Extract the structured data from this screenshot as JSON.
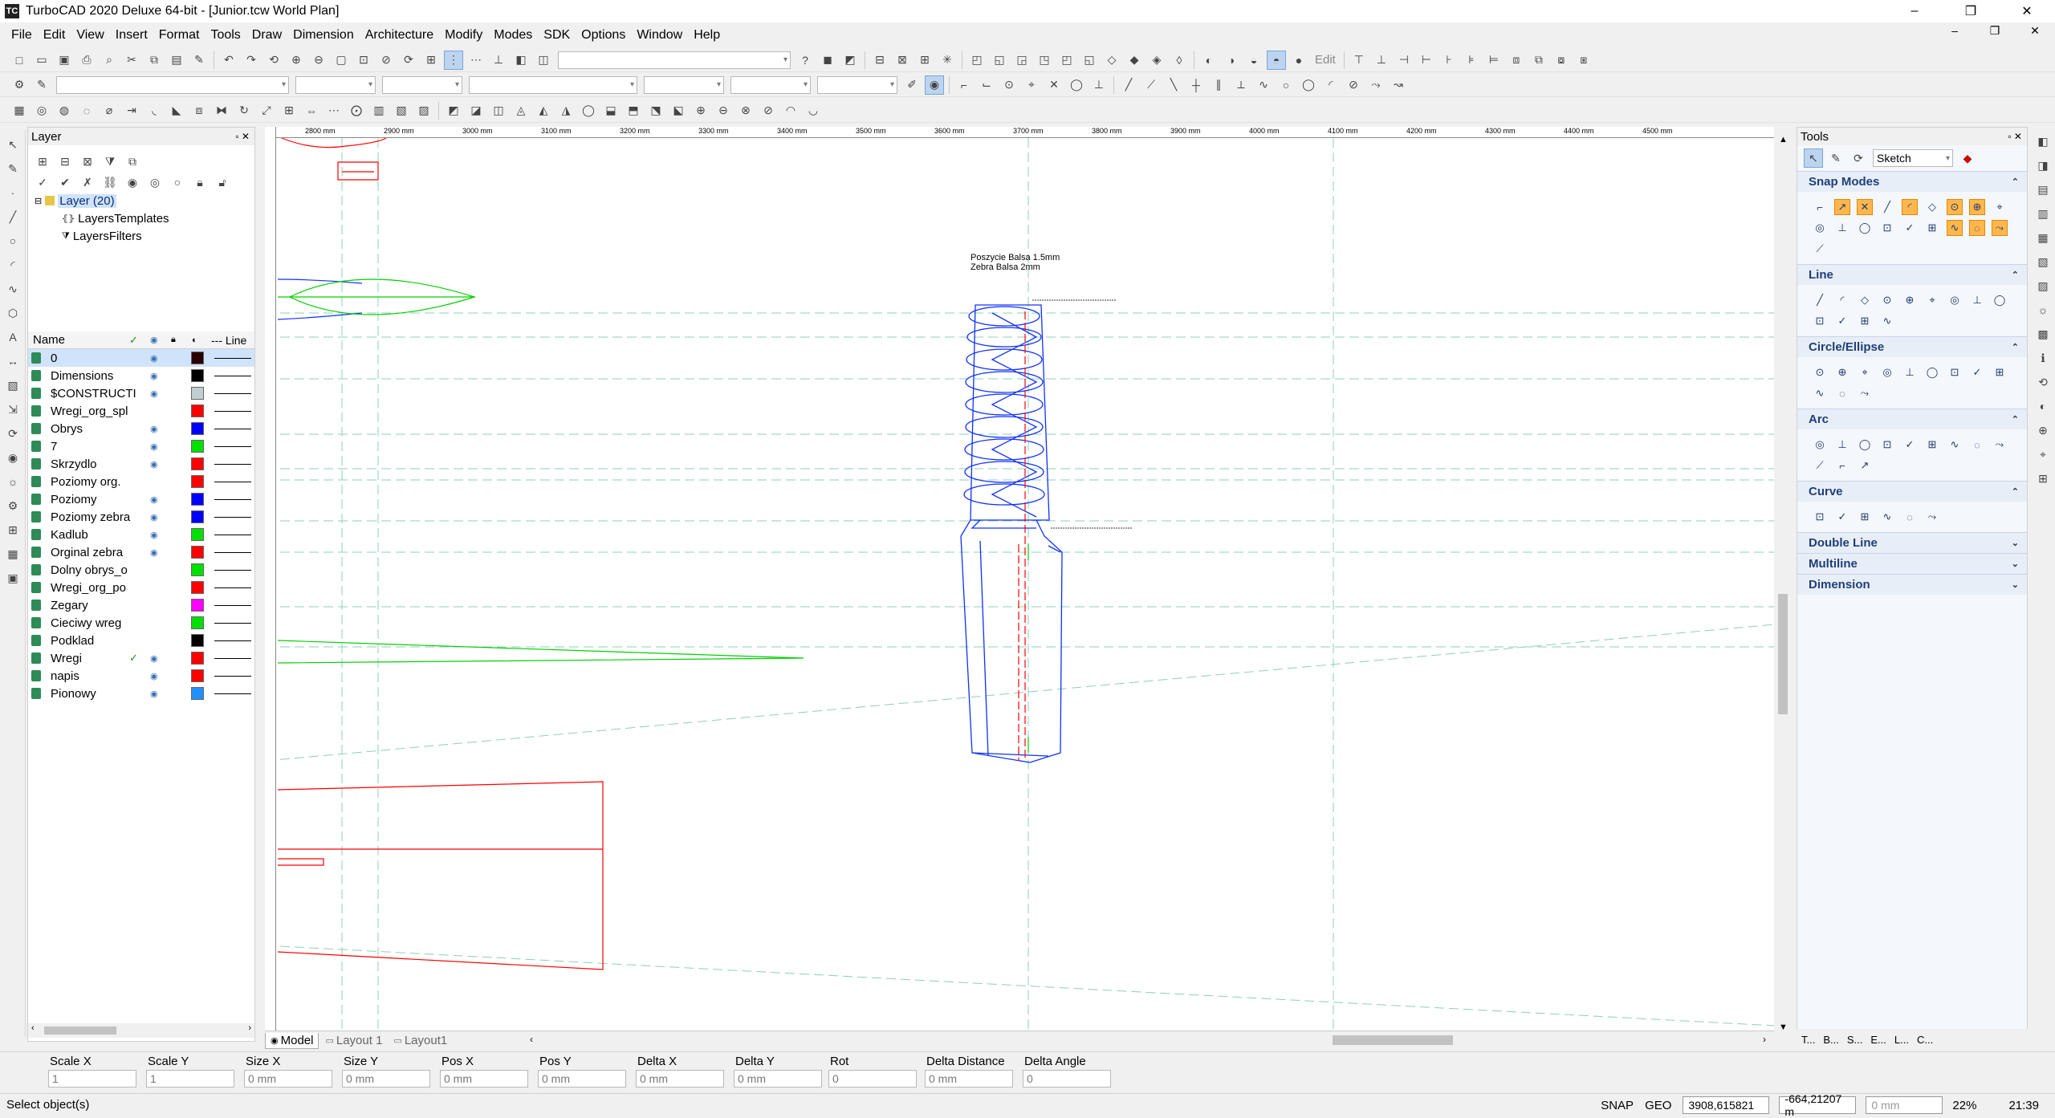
{
  "app": {
    "title": "TurboCAD 2020 Deluxe 64-bit - [Junior.tcw World Plan]",
    "icon_text": "TC",
    "window_buttons": [
      "–",
      "❐",
      "✕"
    ]
  },
  "menu": {
    "items": [
      "File",
      "Edit",
      "View",
      "Insert",
      "Format",
      "Tools",
      "Draw",
      "Dimension",
      "Architecture",
      "Modify",
      "Modes",
      "SDK",
      "Options",
      "Window",
      "Help"
    ],
    "doc_buttons": [
      "–",
      "❐",
      "✕"
    ]
  },
  "toolbar": {
    "edit_label": "Edit"
  },
  "layer_panel": {
    "title": "Layer",
    "tree": [
      {
        "label": "Layer (20)",
        "selected": true
      },
      {
        "label": "LayersTemplates",
        "selected": false
      },
      {
        "label": "LayersFilters",
        "selected": false
      }
    ],
    "columns": {
      "name": "Name",
      "line": "--- Line"
    },
    "layers": [
      {
        "name": "0",
        "visible": true,
        "current": false,
        "color": "#2b0000"
      },
      {
        "name": "Dimensions",
        "visible": true,
        "current": false,
        "color": "#000000"
      },
      {
        "name": "$CONSTRUCTI",
        "visible": true,
        "current": false,
        "color": "#c0d0d0"
      },
      {
        "name": "Wregi_org_spl",
        "visible": false,
        "current": false,
        "color": "#ff0000"
      },
      {
        "name": "Obrys",
        "visible": true,
        "current": false,
        "color": "#0000ff"
      },
      {
        "name": "7",
        "visible": true,
        "current": false,
        "color": "#00e000"
      },
      {
        "name": "Skrzydlo",
        "visible": true,
        "current": false,
        "color": "#ff0000"
      },
      {
        "name": "Poziomy org.",
        "visible": false,
        "current": false,
        "color": "#ff0000"
      },
      {
        "name": "Poziomy",
        "visible": true,
        "current": false,
        "color": "#0000ff"
      },
      {
        "name": "Poziomy zebra",
        "visible": true,
        "current": false,
        "color": "#0000ff"
      },
      {
        "name": "Kadlub",
        "visible": true,
        "current": false,
        "color": "#00e000"
      },
      {
        "name": "Orginal zebra",
        "visible": true,
        "current": false,
        "color": "#ff0000"
      },
      {
        "name": "Dolny obrys_o",
        "visible": false,
        "current": false,
        "color": "#00e000"
      },
      {
        "name": "Wregi_org_po",
        "visible": false,
        "current": false,
        "color": "#ff0000"
      },
      {
        "name": "Zegary",
        "visible": false,
        "current": false,
        "color": "#ff00ff"
      },
      {
        "name": "Cieciwy wreg",
        "visible": false,
        "current": false,
        "color": "#00e000"
      },
      {
        "name": "Podklad",
        "visible": false,
        "current": false,
        "color": "#000000"
      },
      {
        "name": "Wregi",
        "visible": true,
        "current": true,
        "color": "#ff0000"
      },
      {
        "name": "napis",
        "visible": true,
        "current": false,
        "color": "#ff0000"
      },
      {
        "name": "Pionowy",
        "visible": true,
        "current": false,
        "color": "#1e90ff"
      }
    ]
  },
  "ruler": {
    "labels": [
      "2800 mm",
      "2900 mm",
      "3000 mm",
      "3100 mm",
      "3200 mm",
      "3300 mm",
      "3400 mm",
      "3500 mm",
      "3600 mm",
      "3700 mm",
      "3800 mm",
      "3900 mm",
      "4000 mm",
      "4100 mm",
      "4200 mm",
      "4300 mm",
      "4400 mm",
      "4500 mm"
    ]
  },
  "drawing": {
    "note_line1": "Poszycie Balsa 1.5mm",
    "note_line2": "Zebra Balsa 2mm"
  },
  "tabs": [
    "Model",
    "Layout 1",
    "Layout1"
  ],
  "tools_panel": {
    "title": "Tools",
    "mode": "Sketch",
    "sections": [
      {
        "title": "Snap Modes",
        "expanded": true,
        "icons": 19
      },
      {
        "title": "Line",
        "expanded": true,
        "icons": 13
      },
      {
        "title": "Circle/Ellipse",
        "expanded": true,
        "icons": 12
      },
      {
        "title": "Arc",
        "expanded": true,
        "icons": 12
      },
      {
        "title": "Curve",
        "expanded": true,
        "icons": 6
      },
      {
        "title": "Double Line",
        "expanded": false,
        "icons": 0
      },
      {
        "title": "Multiline",
        "expanded": false,
        "icons": 0
      },
      {
        "title": "Dimension",
        "expanded": false,
        "icons": 0
      }
    ],
    "bottom_tabs": [
      "T...",
      "B...",
      "S...",
      "E...",
      "L...",
      "C..."
    ]
  },
  "inspector": {
    "fields": [
      {
        "label": "Scale X",
        "value": "1"
      },
      {
        "label": "Scale Y",
        "value": "1"
      },
      {
        "label": "Size X",
        "value": "0 mm"
      },
      {
        "label": "Size Y",
        "value": "0 mm"
      },
      {
        "label": "Pos X",
        "value": "0 mm"
      },
      {
        "label": "Pos Y",
        "value": "0 mm"
      },
      {
        "label": "Delta X",
        "value": "0 mm"
      },
      {
        "label": "Delta Y",
        "value": "0 mm"
      },
      {
        "label": "Rot",
        "value": "0"
      },
      {
        "label": "Delta Distance",
        "value": "0 mm"
      },
      {
        "label": "Delta Angle",
        "value": "0"
      }
    ]
  },
  "status": {
    "message": "Select object(s)",
    "snap": "SNAP",
    "geo": "GEO",
    "x": "3908,615821",
    "y": "-664,21207 m",
    "dist": "0 mm",
    "zoom": "22%",
    "time": "21:39"
  }
}
